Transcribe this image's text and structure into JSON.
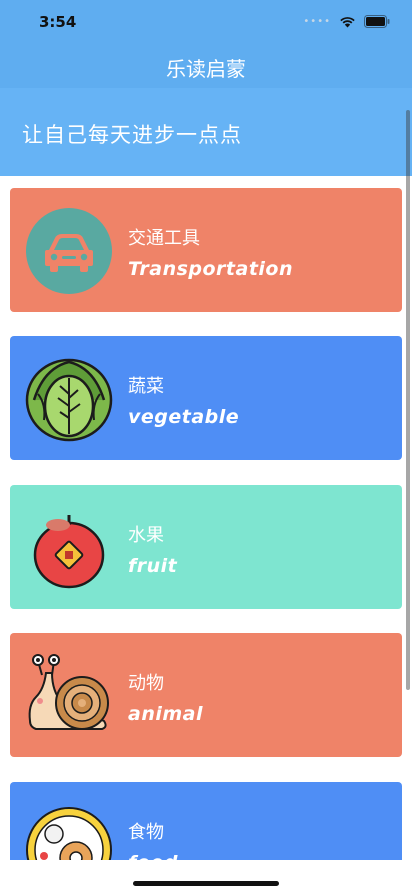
{
  "status": {
    "time": "3:54"
  },
  "nav": {
    "title": "乐读启蒙"
  },
  "banner": {
    "text": "让自己每天进步一点点"
  },
  "categories": [
    {
      "zh": "交通工具",
      "en": "Transportation",
      "color": "#ef8368",
      "icon": "car-icon"
    },
    {
      "zh": "蔬菜",
      "en": "vegetable",
      "color": "#4f8ef5",
      "icon": "cabbage-icon"
    },
    {
      "zh": "水果",
      "en": "fruit",
      "color": "#7ee5d0",
      "icon": "apple-icon"
    },
    {
      "zh": "动物",
      "en": "animal",
      "color": "#ef8368",
      "icon": "snail-icon"
    },
    {
      "zh": "食物",
      "en": "food",
      "color": "#4f8ef5",
      "icon": "food-plate-icon"
    }
  ],
  "colors": {
    "nav": "#5fadf0",
    "banner": "#66b3f5"
  }
}
